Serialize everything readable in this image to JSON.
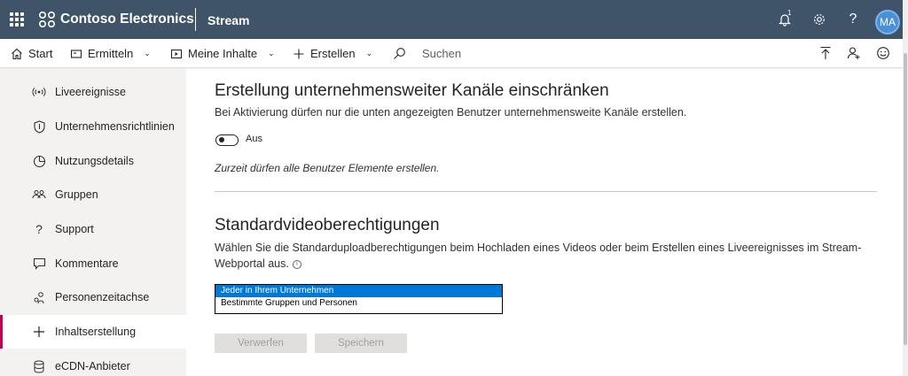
{
  "header": {
    "brand": "Contoso Electronics",
    "app": "Stream",
    "notification_count": "1",
    "help": "?",
    "avatar_initials": "MA",
    "colors": {
      "bar": "#3f5468",
      "avatar": "#4a90d9"
    }
  },
  "nav": {
    "items": [
      {
        "label": "Start",
        "icon": "home-icon"
      },
      {
        "label": "Ermitteln",
        "icon": "discover-icon"
      },
      {
        "label": "Meine Inhalte",
        "icon": "video-icon"
      },
      {
        "label": "Erstellen",
        "icon": "plus-icon"
      }
    ],
    "search_placeholder": "Suchen"
  },
  "sidebar": {
    "active_color": "#c30052",
    "items": [
      {
        "label": "Liveereignisse",
        "icon": "broadcast-icon"
      },
      {
        "label": "Unternehmensrichtlinien",
        "icon": "shield-icon"
      },
      {
        "label": "Nutzungsdetails",
        "icon": "pie-chart-icon"
      },
      {
        "label": "Gruppen",
        "icon": "people-icon"
      },
      {
        "label": "Support",
        "icon": "question-icon"
      },
      {
        "label": "Kommentare",
        "icon": "comment-icon"
      },
      {
        "label": "Personenzeitachse",
        "icon": "people-timeline-icon"
      },
      {
        "label": "Inhaltserstellung",
        "icon": "plus-icon"
      },
      {
        "label": "eCDN-Anbieter",
        "icon": "database-icon"
      }
    ]
  },
  "main": {
    "section1": {
      "title": "Erstellung unternehmensweiter Kanäle einschränken",
      "description": "Bei Aktivierung dürfen nur die unten angezeigten Benutzer unternehmensweite Kanäle erstellen.",
      "toggle_label": "Aus",
      "note": "Zurzeit dürfen alle Benutzer Elemente erstellen."
    },
    "section2": {
      "title": "Standardvideoberechtigungen",
      "description": "Wählen Sie die Standarduploadberechtigungen beim Hochladen eines Videos oder beim Erstellen eines Liveereignisses im Stream-Webportal aus.",
      "options": [
        "Jeder in Ihrem Unternehmen",
        "Bestimmte Gruppen und Personen"
      ],
      "selected_index": 0
    },
    "buttons": {
      "discard": "Verwerfen",
      "save": "Speichern"
    }
  }
}
